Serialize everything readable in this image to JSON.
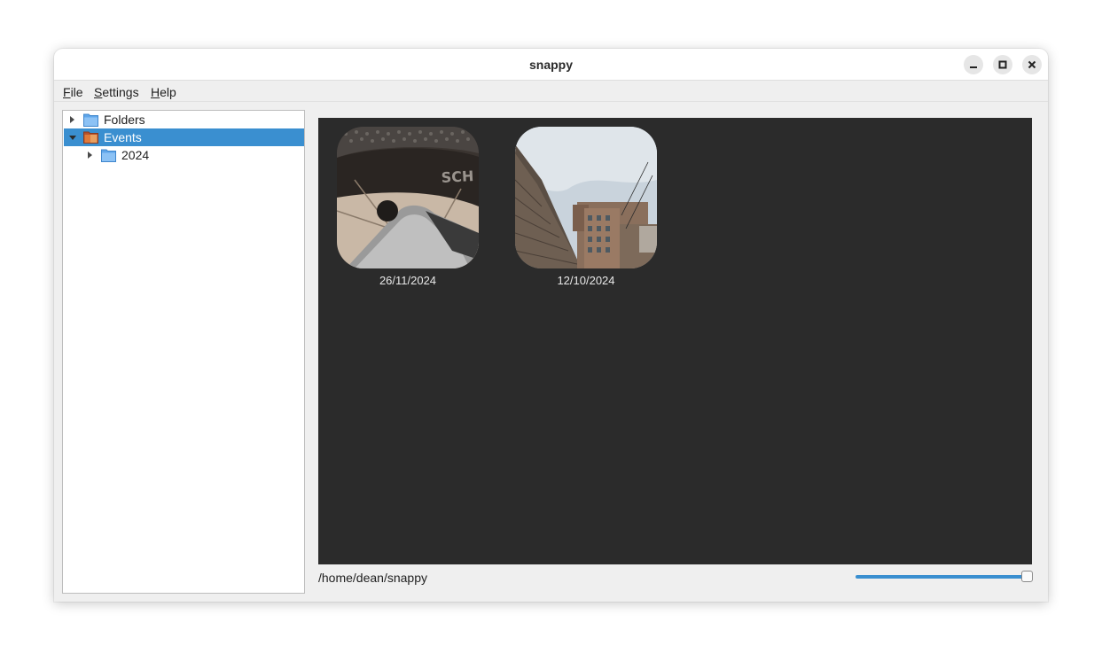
{
  "window": {
    "title": "snappy",
    "controls": {
      "minimize": "minimize",
      "maximize": "maximize",
      "close": "close"
    }
  },
  "menubar": {
    "file": {
      "u": "F",
      "rest": "ile"
    },
    "settings": {
      "u": "S",
      "rest": "ettings"
    },
    "help": {
      "u": "H",
      "rest": "elp"
    }
  },
  "tree": {
    "items": [
      {
        "label": "Folders",
        "expanded": false,
        "selected": false,
        "icon": "folder-icon"
      },
      {
        "label": "Events",
        "expanded": true,
        "selected": true,
        "icon": "event-folder-icon"
      },
      {
        "label": "2024",
        "expanded": false,
        "selected": false,
        "icon": "folder-icon"
      }
    ]
  },
  "gallery": {
    "thumbnails": [
      {
        "caption": "26/11/2024",
        "subject": "bicycle tyre and frame"
      },
      {
        "caption": "12/10/2024",
        "subject": "brick building and sky"
      }
    ]
  },
  "statusbar": {
    "path": "/home/dean/snappy",
    "zoom_level": 1.0
  },
  "colors": {
    "accent": "#3a8fd0",
    "gallery_background": "#2b2b2b",
    "window_background": "#efefef"
  }
}
